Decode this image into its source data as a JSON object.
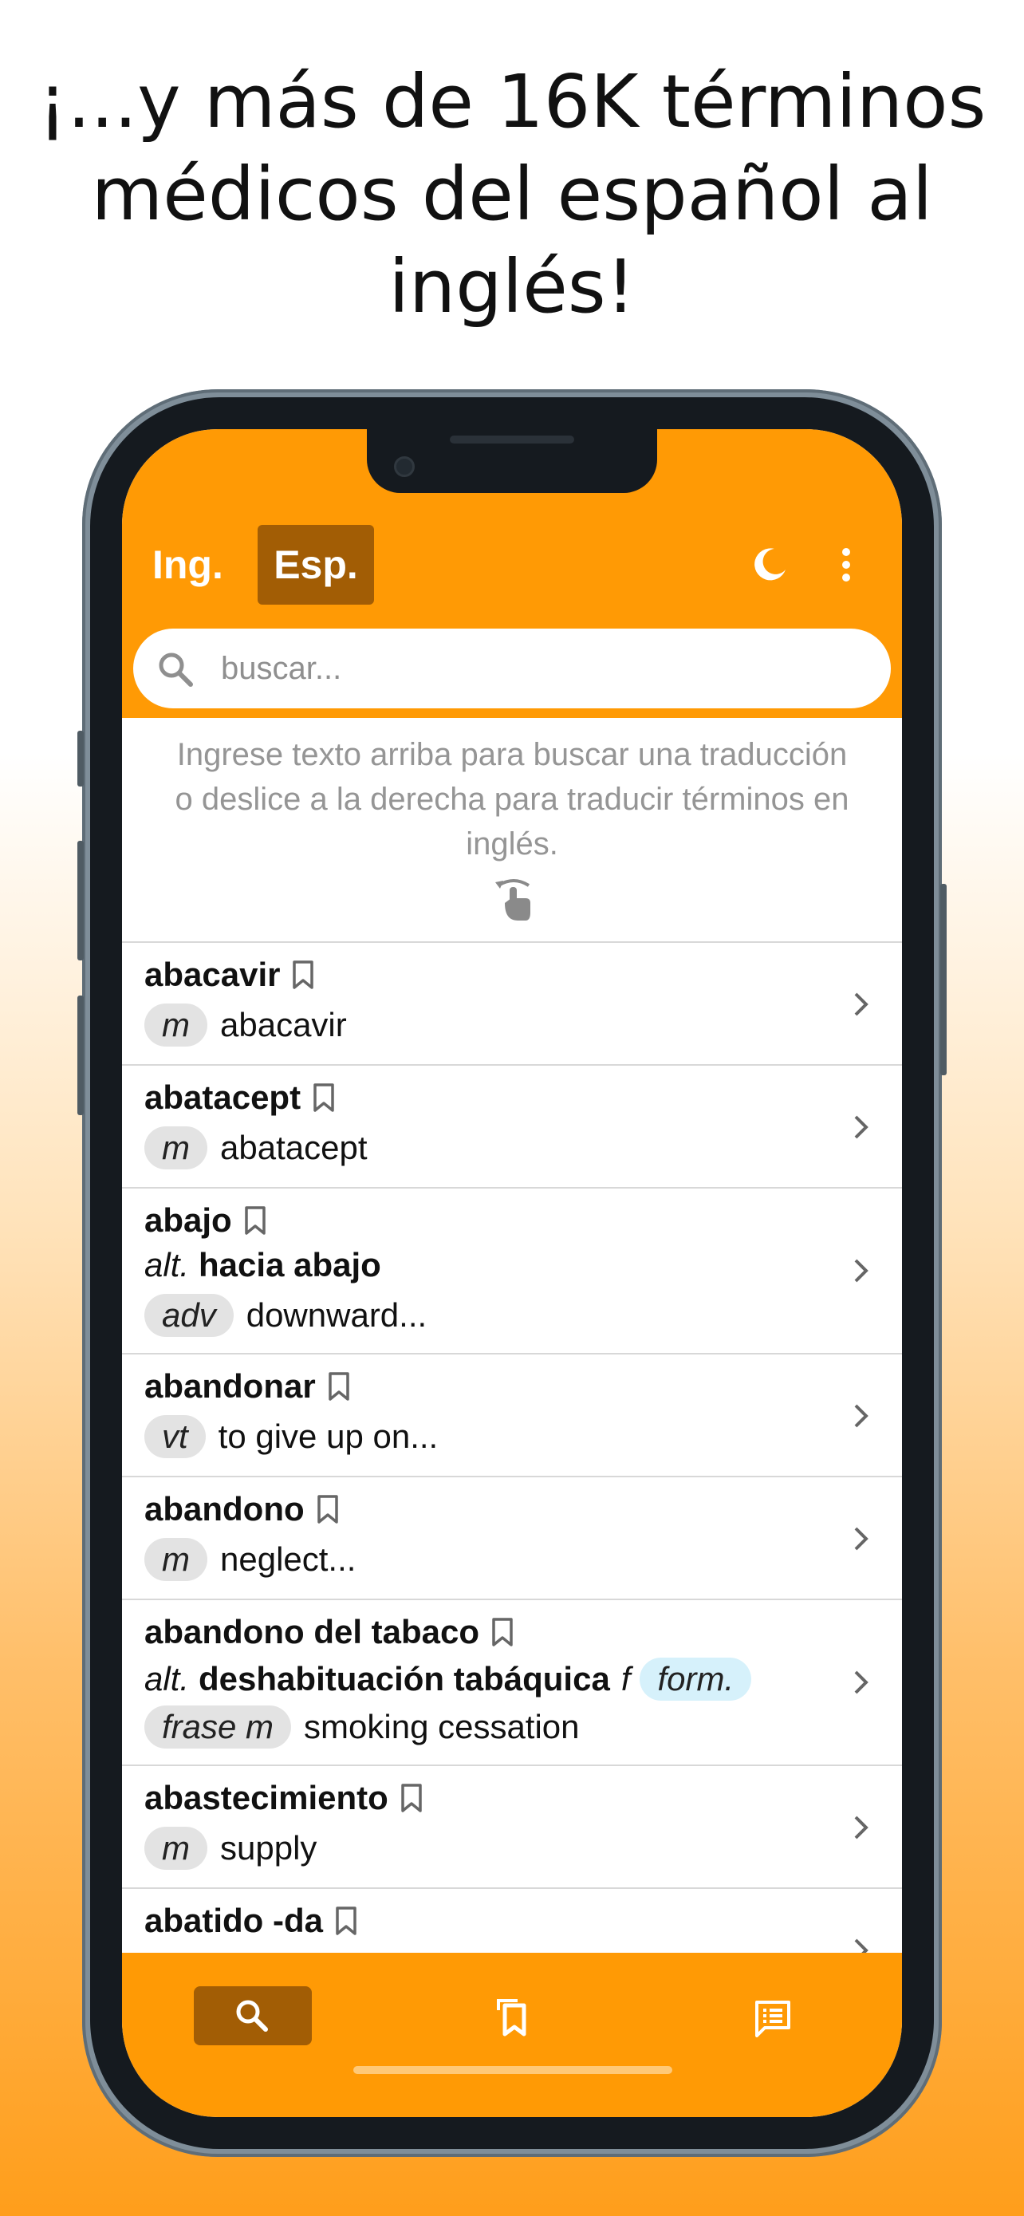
{
  "headline": [
    "¡...y más de 16K términos",
    "médicos del español al",
    "inglés!"
  ],
  "header": {
    "tab_ing": "Ing.",
    "tab_esp": "Esp.",
    "active_tab": "Esp."
  },
  "search": {
    "placeholder": "buscar..."
  },
  "hint": [
    "Ingrese texto arriba para buscar una traducción",
    "o deslice a la derecha para traducir términos en",
    "inglés."
  ],
  "entries": [
    {
      "term": "abacavir",
      "gender": "m",
      "translation": "abacavir"
    },
    {
      "term": "abatacept",
      "gender": "m",
      "translation": "abatacept"
    },
    {
      "term": "abajo",
      "alt_label": "alt.",
      "alt": "hacia abajo",
      "gender": "adv",
      "translation": "downward..."
    },
    {
      "term": "abandonar",
      "gender": "vt",
      "translation": "to give up on..."
    },
    {
      "term": "abandono",
      "gender": "m",
      "translation": "neglect..."
    },
    {
      "term": "abandono del tabaco",
      "alt_label": "alt.",
      "alt": "deshabituación tabáquica",
      "alt_gender": "f",
      "alt_tag": "form.",
      "gender": "frase m",
      "translation": "smoking cessation"
    },
    {
      "term": "abastecimiento",
      "gender": "m",
      "translation": "supply"
    },
    {
      "term": "abatido -da"
    }
  ],
  "colors": {
    "accent": "#ff9a05",
    "accent_dark": "#a25d05",
    "pill": "#e3e3e3",
    "pill_blue": "#d6f1fb"
  },
  "icons": {
    "theme": "moon-icon",
    "menu": "more-vertical-icon",
    "search": "search-icon",
    "bookmark": "bookmark-icon",
    "chevron": "chevron-right-icon",
    "swipe": "swipe-gesture-icon",
    "nav": [
      "search-icon",
      "bookmarks-icon",
      "notes-icon"
    ]
  }
}
